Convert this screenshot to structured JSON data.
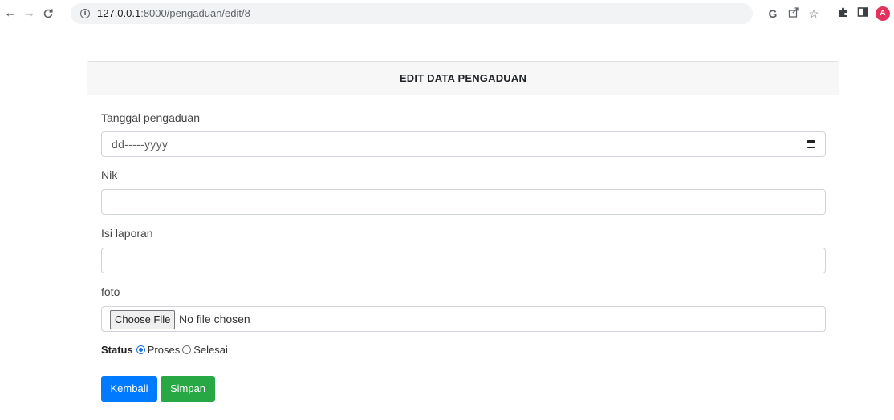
{
  "browser": {
    "url_host": "127.0.0.1",
    "url_rest": ":8000/pengaduan/edit/8",
    "avatar_letter": "A",
    "g_icon_letter": "G"
  },
  "form": {
    "title": "EDIT DATA PENGADUAN",
    "fields": {
      "tanggal_label": "Tanggal pengaduan",
      "tanggal_placeholder": "dd-----yyyy",
      "nik_label": "Nik",
      "nik_value": "",
      "isi_label": "Isi laporan",
      "isi_value": "",
      "foto_label": "foto",
      "file_button": "Choose File",
      "file_status": "No file chosen"
    },
    "status": {
      "label": "Status",
      "options": [
        "Proses",
        "Selesai"
      ],
      "selected": "Proses"
    },
    "buttons": {
      "back": "Kembali",
      "save": "Simpan"
    }
  },
  "colors": {
    "primary": "#007bff",
    "success": "#28a745",
    "header_bg": "#f7f7f7"
  }
}
